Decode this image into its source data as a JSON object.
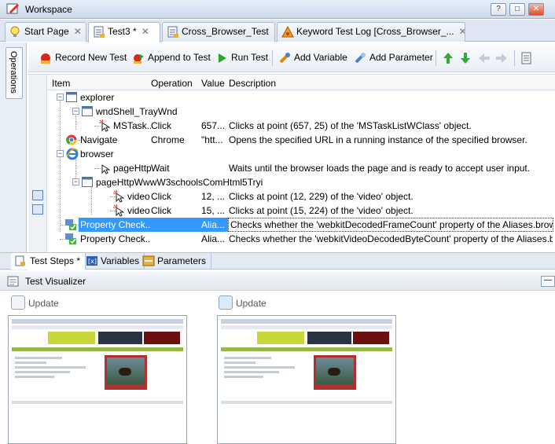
{
  "window": {
    "title": "Workspace",
    "buttons": [
      "?",
      "□",
      "✕"
    ]
  },
  "tabs": [
    {
      "label": "Start Page",
      "active": false
    },
    {
      "label": "Test3 *",
      "active": true
    },
    {
      "label": "Cross_Browser_Test",
      "active": false
    },
    {
      "label": "Keyword Test Log [Cross_Browser_...",
      "active": false
    }
  ],
  "operations_panel": {
    "label": "Operations"
  },
  "toolbar": {
    "record_new_test": "Record New Test",
    "append_to_test": "Append to Test",
    "run_test": "Run Test",
    "add_variable": "Add Variable",
    "add_parameter": "Add Parameter"
  },
  "grid": {
    "columns": {
      "item": "Item",
      "operation": "Operation",
      "value": "Value",
      "description": "Description"
    },
    "rows": [
      {
        "item": "explorer",
        "operation": "",
        "value": "",
        "description": "",
        "icon": "window-icon"
      },
      {
        "item": "wndShell_TrayWnd",
        "operation": "",
        "value": "",
        "description": "",
        "icon": "window-icon"
      },
      {
        "item": "MSTask...",
        "operation": "Click",
        "value": "657...",
        "description": "Clicks at point (657, 25) of the 'MSTaskListWClass' object.",
        "icon": "click-icon"
      },
      {
        "item": "Navigate",
        "operation": "Chrome",
        "value": "\"htt...",
        "description": "Opens the specified URL in a running instance of the specified browser.",
        "icon": "chrome-icon"
      },
      {
        "item": "browser",
        "operation": "",
        "value": "",
        "description": "",
        "icon": "ie-icon"
      },
      {
        "item": "pageHttpW...",
        "operation": "Wait",
        "value": "",
        "description": "Waits until the browser loads the page and is ready to accept user input.",
        "icon": "click-icon"
      },
      {
        "item": "pageHttpWwwW3schoolsComHtml5Tryi",
        "operation": "",
        "value": "",
        "description": "",
        "icon": "window-icon"
      },
      {
        "item": "video",
        "operation": "Click",
        "value": "12, ...",
        "description": "Clicks at point (12, 229) of the 'video' object.",
        "icon": "click-icon"
      },
      {
        "item": "video",
        "operation": "Click",
        "value": "15, ...",
        "description": "Clicks at point (15, 224) of the 'video' object.",
        "icon": "click-icon"
      },
      {
        "item": "Property Check...",
        "operation": "",
        "value": "Alia...",
        "description": "Checks whether the 'webkitDecodedFrameCount' property of the Aliases.browser.p...",
        "icon": "checkpoint-icon"
      },
      {
        "item": "Property Check...",
        "operation": "",
        "value": "Alia...",
        "description": "Checks whether the 'webkitVideoDecodedByteCount' property of the Aliases.brows...",
        "icon": "checkpoint-icon"
      }
    ]
  },
  "bottom_tabs": [
    {
      "label": "Test Steps *",
      "active": true
    },
    {
      "label": "Variables",
      "active": false
    },
    {
      "label": "Parameters",
      "active": false
    }
  ],
  "visualizer": {
    "title": "Test Visualizer",
    "update_left": "Update",
    "update_right": "Update"
  }
}
